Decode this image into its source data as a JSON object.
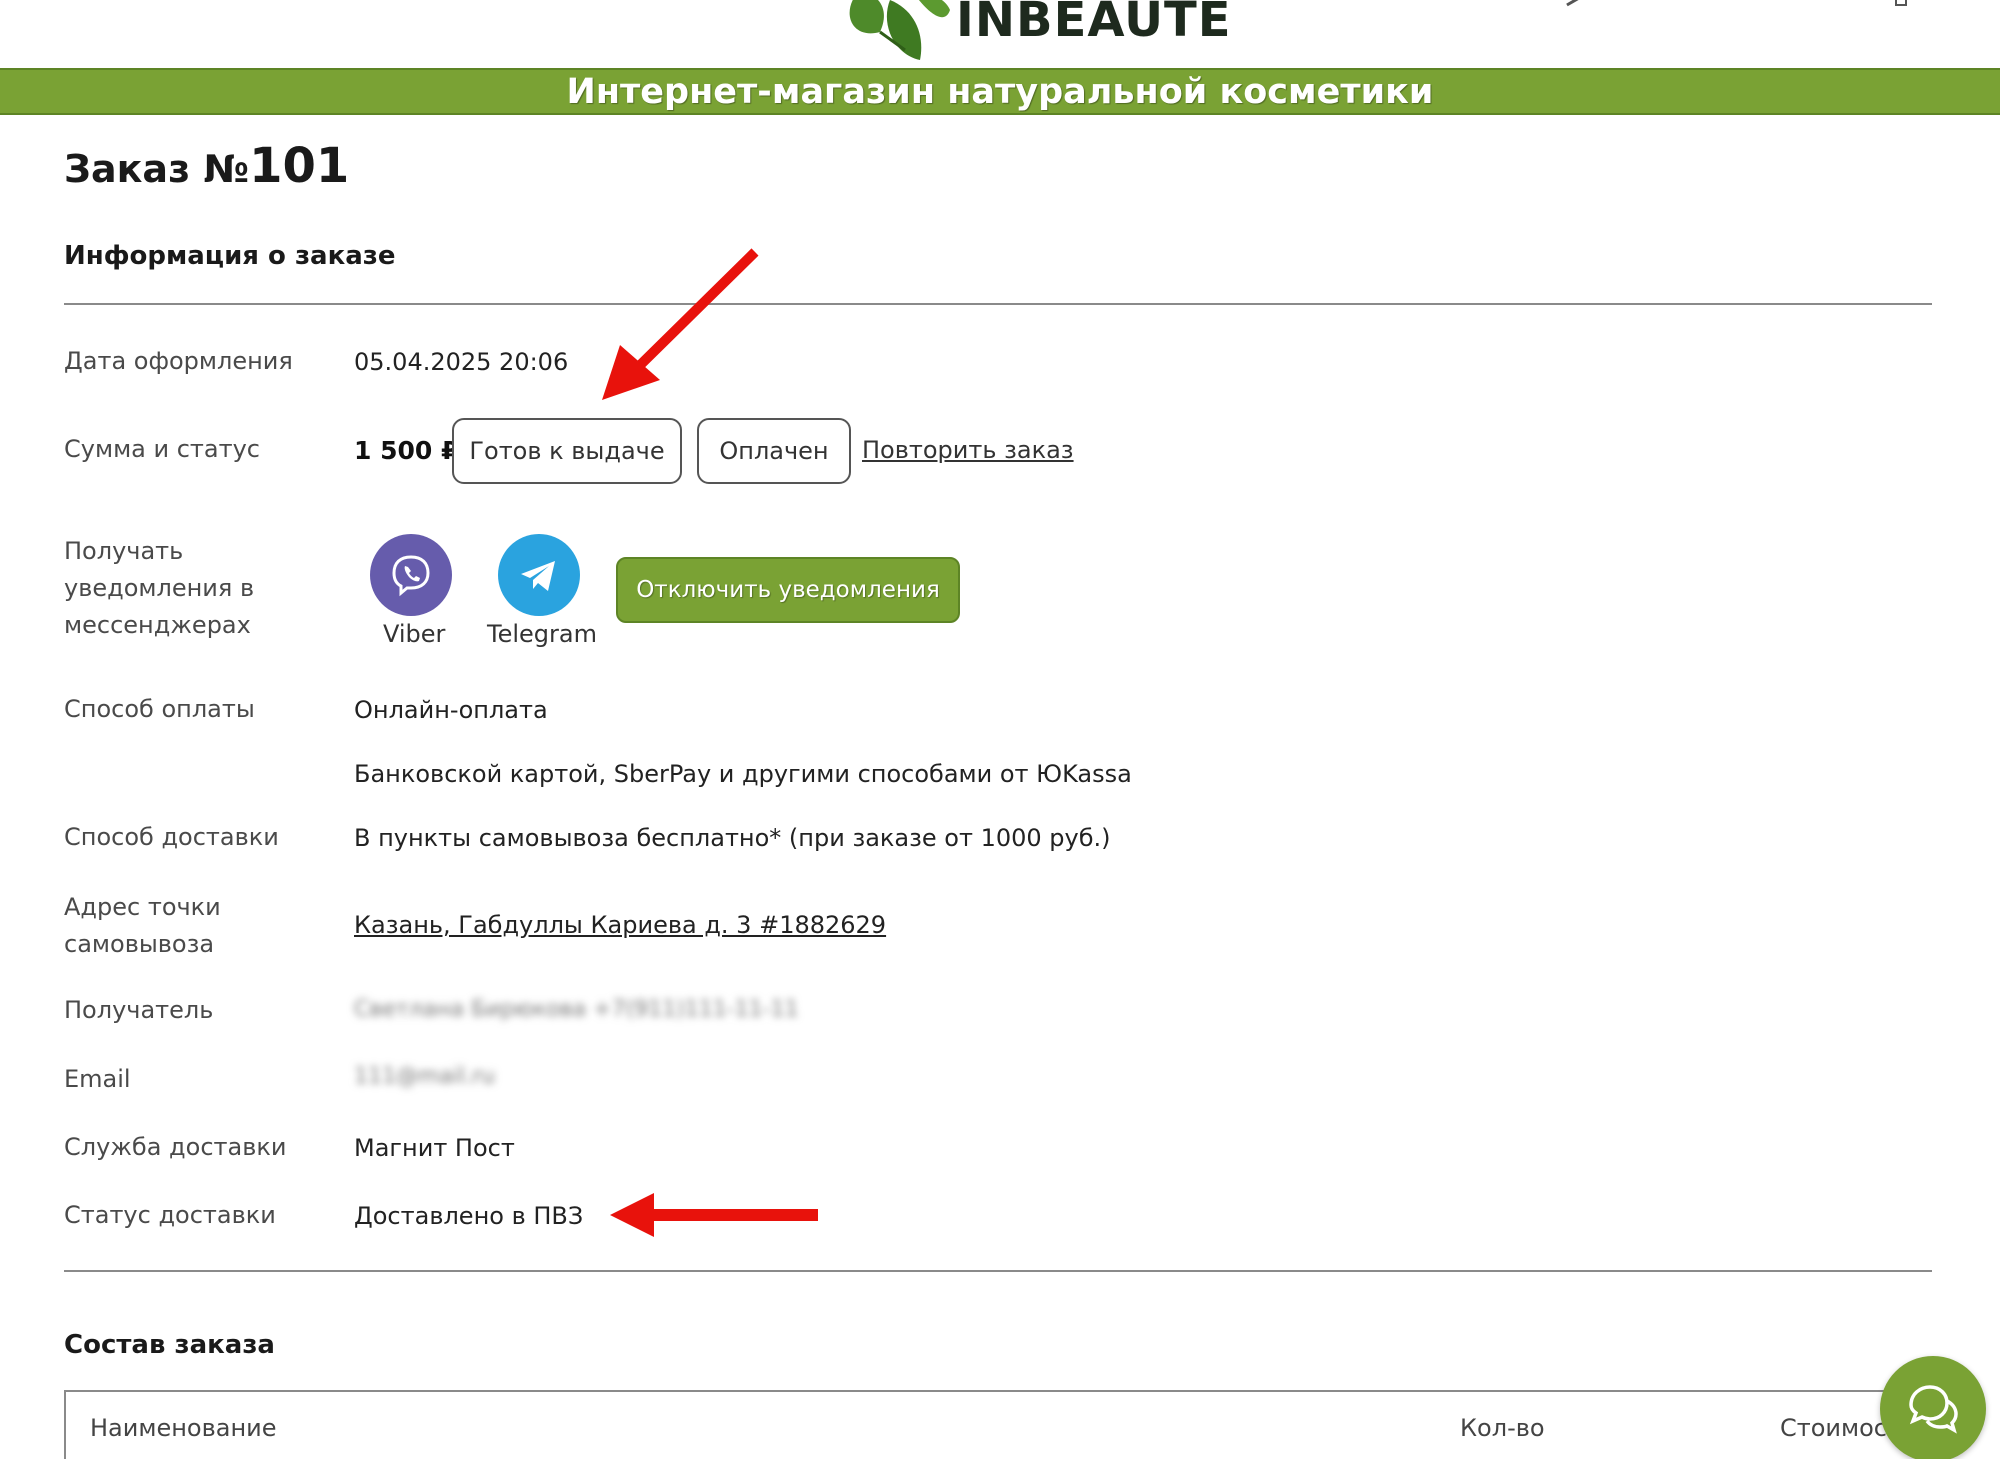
{
  "header": {
    "logo_text": "INBEAUTE",
    "banner_text": "Интернет-магазин натуральной косметики"
  },
  "order": {
    "title_prefix": "Заказ №",
    "number": "101"
  },
  "info_section": {
    "title": "Информация о заказе",
    "date_label": "Дата оформления",
    "date_value": "05.04.2025 20:06",
    "sum_label": "Сумма и статус",
    "price": "1 500 ₽",
    "status_ready": "Готов к выдаче",
    "status_paid": "Оплачен",
    "repeat_link": "Повторить заказ",
    "notify_label": "Получать уведомления в мессенджерах",
    "messengers": [
      {
        "name": "Viber",
        "icon": "viber-icon",
        "color": "#665CAC"
      },
      {
        "name": "Telegram",
        "icon": "telegram-icon",
        "color": "#2AA3DF"
      }
    ],
    "notify_button": "Отключить уведомления",
    "payment_label": "Способ оплаты",
    "payment_value": "Онлайн-оплата",
    "payment_detail": "Банковской картой, SberPay и другими способами от ЮKassa",
    "delivery_label": "Способ доставки",
    "delivery_value": "В пункты самовывоза бесплатно* (при заказе от 1000 руб.)",
    "pickup_label": "Адрес точки самовывоза",
    "pickup_value": "Казань, Габдуллы Кариева д. 3 #1882629",
    "recipient_label": "Получатель",
    "recipient_value": "Светлана Бирюкова +7(911)111-11-11",
    "email_label": "Email",
    "email_value": "111@mail.ru",
    "service_label": "Служба доставки",
    "service_value": "Магнит Пост",
    "delivery_status_label": "Статус доставки",
    "delivery_status_value": "Доставлено в ПВЗ"
  },
  "composition_section": {
    "title": "Состав заказа",
    "columns": [
      "Наименование",
      "Кол-во",
      "Стоимость"
    ]
  },
  "colors": {
    "brand_green": "#7aa234",
    "annotation_red": "#e8120c"
  }
}
